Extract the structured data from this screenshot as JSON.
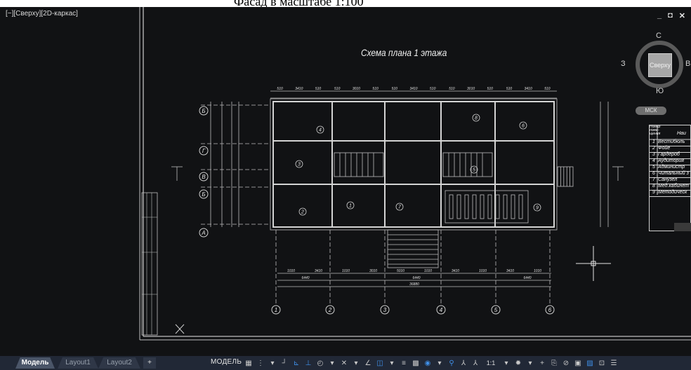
{
  "top_caption": "Фасад в масштабе 1:100",
  "viewport": {
    "label": "[−][Сверху][2D-каркас]",
    "window_controls": [
      "_",
      "◘",
      "✕"
    ]
  },
  "plan": {
    "title": "Схема плана 1 этажа",
    "axis_letters": [
      "Б",
      "Г",
      "В",
      "Б",
      "А"
    ],
    "axis_numbers": [
      "1",
      "2",
      "3",
      "4",
      "5",
      "6"
    ],
    "top_dims": [
      "510",
      "3410",
      "510",
      "510",
      "3010",
      "510",
      "510",
      "3410",
      "510",
      "510",
      "3010",
      "510",
      "510",
      "3410",
      "510"
    ],
    "bottom_dims": [
      "1010",
      "3410",
      "1010",
      "3010",
      "5010",
      "1010",
      "3410",
      "1010",
      "3410",
      "1010"
    ],
    "bottom_totals": [
      "6440",
      "6440",
      "6440"
    ],
    "overall": "36880",
    "room_marks": [
      "4",
      "3",
      "2",
      "1",
      "7",
      "8",
      "6",
      "5",
      "9"
    ]
  },
  "viewcube": {
    "north": "С",
    "south": "Ю",
    "west": "З",
    "east": "В",
    "face": "Сверху"
  },
  "wcs": "МСК",
  "legend": {
    "header_short": "Номер поме- щения",
    "header_name": "Наи",
    "rows": [
      {
        "num": "1",
        "name": "Вестибюль"
      },
      {
        "num": "2",
        "name": "Фойе"
      },
      {
        "num": "3",
        "name": "Гардероб"
      },
      {
        "num": "4",
        "name": "Аудитория"
      },
      {
        "num": "5",
        "name": "Администр"
      },
      {
        "num": "6",
        "name": "Читальный з"
      },
      {
        "num": "7",
        "name": "Санузел"
      },
      {
        "num": "8",
        "name": "Мед.кабинет"
      },
      {
        "num": "9",
        "name": "Методическ"
      }
    ]
  },
  "status": {
    "tabs": [
      "Модель",
      "Layout1",
      "Layout2"
    ],
    "add_tab": "+",
    "model_button": "МОДЕЛЬ",
    "scale": "1:1",
    "icons": [
      "grid-icon",
      "snap-icon",
      "ortho-icon",
      "polar-icon",
      "osnap-icon",
      "otrack-icon",
      "ducs-icon",
      "lineweight-icon",
      "transparency-icon",
      "selection-cycling-icon",
      "annotation-visibility-icon",
      "autoscale-icon",
      "workspace-icon",
      "annotation-monitor-icon",
      "isolate-icon",
      "hardware-acceleration-icon",
      "clean-screen-icon",
      "customization-icon"
    ],
    "colors": {
      "bar": "#212836",
      "accent": "#3f8fe8"
    }
  }
}
